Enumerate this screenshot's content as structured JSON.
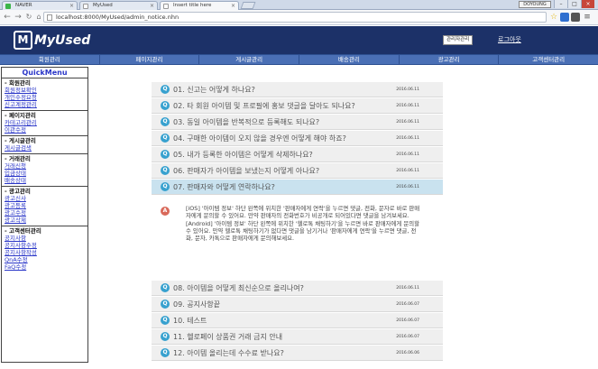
{
  "browser": {
    "tabs": [
      {
        "label": "NAVER",
        "active": false
      },
      {
        "label": "MyUsed",
        "active": false
      },
      {
        "label": "Insert title here",
        "active": true
      }
    ],
    "url": "localhost:8000/MyUsed/admin_notice.nhn",
    "user": "DOYOUNG"
  },
  "header": {
    "logo_mark": "M",
    "logo_text": "MyUsed",
    "admin_button": "관리자관리",
    "logout": "로그아웃"
  },
  "nav": [
    "회원관리",
    "페이지관리",
    "게시글관리",
    "배송관리",
    "광고관리",
    "고객센터관리"
  ],
  "sidebar": {
    "title": "QuickMenu",
    "sections": [
      {
        "title": "- 회원관리",
        "links": [
          "회원정보확인",
          "개인수정요청",
          "신고계정관리"
        ]
      },
      {
        "title": "- 페이지관리",
        "links": [
          "카테고리관리",
          "이관수정"
        ]
      },
      {
        "title": "- 게시글관리",
        "links": [
          "게시글검색"
        ]
      },
      {
        "title": "- 거래관리",
        "links": [
          "거래신청",
          "입금상태",
          "배송상태"
        ]
      },
      {
        "title": "- 광고관리",
        "links": [
          "광고신사",
          "광고등록",
          "광고수정",
          "광고삭제"
        ]
      },
      {
        "title": "- 고객센터관리",
        "links": [
          "공지사항",
          "공지사항수정",
          "공지사항작성",
          "QnA수정",
          "FaQ수정"
        ]
      }
    ]
  },
  "faq": {
    "items": [
      {
        "q": "01. 신고는 어떻게 하나요?",
        "date": "2016.06.11",
        "active": false
      },
      {
        "q": "02. 타 회원 아이템 및 프로필에 홍보 댓글을 달아도 되나요?",
        "date": "2016.06.11",
        "active": false
      },
      {
        "q": "03. 동일 아이템을 반복적으로 등록해도 되나요?",
        "date": "2016.06.11",
        "active": false
      },
      {
        "q": "04. 구매한 아이템이 오지 않을 경우엔 어떻게 해야 하죠?",
        "date": "2016.06.11",
        "active": false
      },
      {
        "q": "05. 내가 등록한 아이템은 어떻게 삭제하나요?",
        "date": "2016.06.11",
        "active": false
      },
      {
        "q": "06. 판매자가 아이템을 보냈는지 어떻게 아나요?",
        "date": "2016.06.11",
        "active": false
      },
      {
        "q": "07. 판매자와 어떻게 연락하나요?",
        "date": "2016.06.11",
        "active": true
      },
      {
        "q": "08. 아이템을 어떻게 최신순으로 올리나여?",
        "date": "2016.06.11",
        "active": false
      },
      {
        "q": "09. 공지사항끝",
        "date": "2016.06.07",
        "active": false
      },
      {
        "q": "10. 테스트",
        "date": "2016.06.07",
        "active": false
      },
      {
        "q": "11. 헬로페이 상품권 거래 금지 안내",
        "date": "2016.06.07",
        "active": false
      },
      {
        "q": "12. 아이템 올리는데 수수료 받나요?",
        "date": "2016.06.06",
        "active": false
      }
    ],
    "answer": "[iOS] '아이템 정보' 하단 왼쪽에 위치한 '판매자에게 연락'을 누르면 댓글, 전화, 문자로 바로 판매자에게 문의할 수 있어요. 만약 판매자의 전화번호가 비공개로 되어있다면 댓글을 남겨보세요. [Android] '아이템 정보' 하단 왼쪽에 위치한 '헬로톡 채팅하기'을 누르면 바로 판매자에게 문의할 수 있어요. 만약 헬로톡 채팅하기가 없다면 댓글을 남기거나 '판매자에게 연락'을 누르면 댓글, 전화, 문자, 카톡으로 판매자에게 문의해보세요."
  },
  "colors": {
    "header_bg": "#1c3168",
    "nav_bg": "#4a6fb5",
    "q_icon": "#37a1cf",
    "a_icon": "#d9695a",
    "active_row": "#c9e2ef"
  }
}
